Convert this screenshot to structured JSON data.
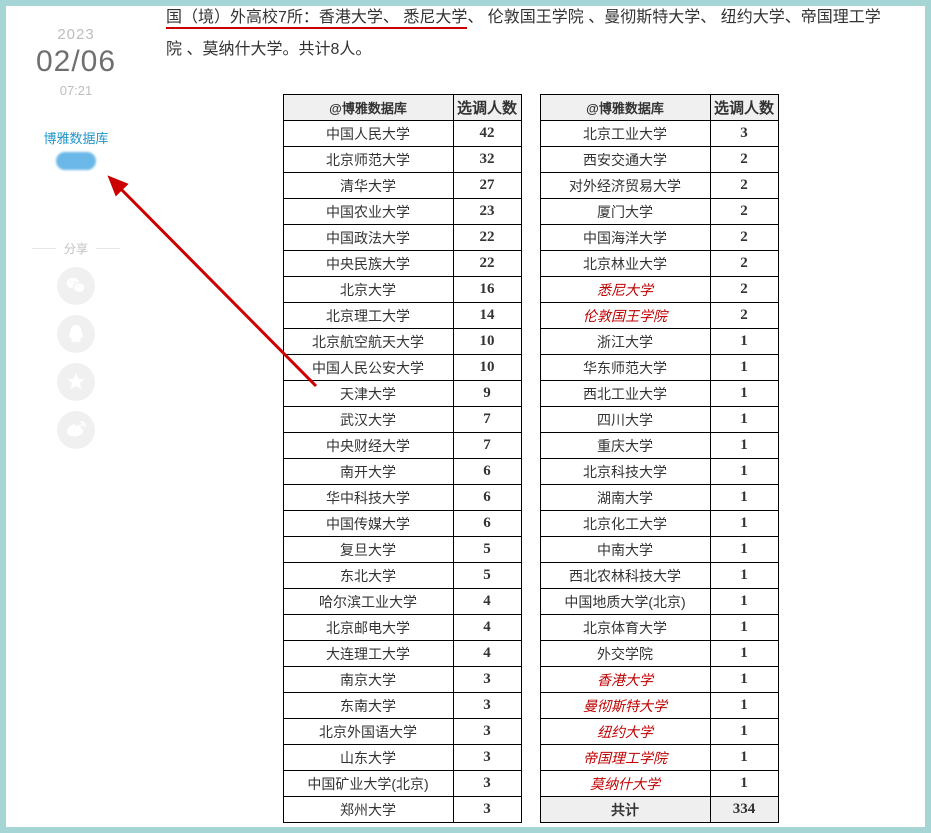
{
  "date": {
    "year": "2023",
    "month_day": "02/06",
    "time": "07:21"
  },
  "source_link": "博雅数据库",
  "share_label": "分享",
  "paragraph": {
    "seg_red1": "国（境）外高校7所：香港大学",
    "seg_red2": "、 悉尼大学",
    "seg_rest": "、 伦敦国王学院 、曼彻斯特大学、 纽约大学、帝国理工学院 、莫纳什大学。共计8人。"
  },
  "table_headers": {
    "name": "@博雅数据库",
    "count": "选调人数"
  },
  "left_table": [
    {
      "name": "中国人民大学",
      "count": "42"
    },
    {
      "name": "北京师范大学",
      "count": "32"
    },
    {
      "name": "清华大学",
      "count": "27"
    },
    {
      "name": "中国农业大学",
      "count": "23"
    },
    {
      "name": "中国政法大学",
      "count": "22"
    },
    {
      "name": "中央民族大学",
      "count": "22"
    },
    {
      "name": "北京大学",
      "count": "16"
    },
    {
      "name": "北京理工大学",
      "count": "14"
    },
    {
      "name": "北京航空航天大学",
      "count": "10"
    },
    {
      "name": "中国人民公安大学",
      "count": "10"
    },
    {
      "name": "天津大学",
      "count": "9"
    },
    {
      "name": "武汉大学",
      "count": "7"
    },
    {
      "name": "中央财经大学",
      "count": "7"
    },
    {
      "name": "南开大学",
      "count": "6"
    },
    {
      "name": "华中科技大学",
      "count": "6"
    },
    {
      "name": "中国传媒大学",
      "count": "6"
    },
    {
      "name": "复旦大学",
      "count": "5"
    },
    {
      "name": "东北大学",
      "count": "5"
    },
    {
      "name": "哈尔滨工业大学",
      "count": "4"
    },
    {
      "name": "北京邮电大学",
      "count": "4"
    },
    {
      "name": "大连理工大学",
      "count": "4"
    },
    {
      "name": "南京大学",
      "count": "3"
    },
    {
      "name": "东南大学",
      "count": "3"
    },
    {
      "name": "北京外国语大学",
      "count": "3"
    },
    {
      "name": "山东大学",
      "count": "3"
    },
    {
      "name": "中国矿业大学(北京)",
      "count": "3"
    },
    {
      "name": "郑州大学",
      "count": "3"
    }
  ],
  "right_table": [
    {
      "name": "北京工业大学",
      "count": "3",
      "red": false
    },
    {
      "name": "西安交通大学",
      "count": "2",
      "red": false
    },
    {
      "name": "对外经济贸易大学",
      "count": "2",
      "red": false
    },
    {
      "name": "厦门大学",
      "count": "2",
      "red": false
    },
    {
      "name": "中国海洋大学",
      "count": "2",
      "red": false
    },
    {
      "name": "北京林业大学",
      "count": "2",
      "red": false
    },
    {
      "name": "悉尼大学",
      "count": "2",
      "red": true
    },
    {
      "name": "伦敦国王学院",
      "count": "2",
      "red": true
    },
    {
      "name": "浙江大学",
      "count": "1",
      "red": false
    },
    {
      "name": "华东师范大学",
      "count": "1",
      "red": false
    },
    {
      "name": "西北工业大学",
      "count": "1",
      "red": false
    },
    {
      "name": "四川大学",
      "count": "1",
      "red": false
    },
    {
      "name": "重庆大学",
      "count": "1",
      "red": false
    },
    {
      "name": "北京科技大学",
      "count": "1",
      "red": false
    },
    {
      "name": "湖南大学",
      "count": "1",
      "red": false
    },
    {
      "name": "北京化工大学",
      "count": "1",
      "red": false
    },
    {
      "name": "中南大学",
      "count": "1",
      "red": false
    },
    {
      "name": "西北农林科技大学",
      "count": "1",
      "red": false
    },
    {
      "name": "中国地质大学(北京)",
      "count": "1",
      "red": false
    },
    {
      "name": "北京体育大学",
      "count": "1",
      "red": false
    },
    {
      "name": "外交学院",
      "count": "1",
      "red": false
    },
    {
      "name": "香港大学",
      "count": "1",
      "red": true
    },
    {
      "name": "曼彻斯特大学",
      "count": "1",
      "red": true
    },
    {
      "name": "纽约大学",
      "count": "1",
      "red": true
    },
    {
      "name": "帝国理工学院",
      "count": "1",
      "red": true
    },
    {
      "name": "莫纳什大学",
      "count": "1",
      "red": true
    }
  ],
  "total_row": {
    "label": "共计",
    "value": "334"
  }
}
